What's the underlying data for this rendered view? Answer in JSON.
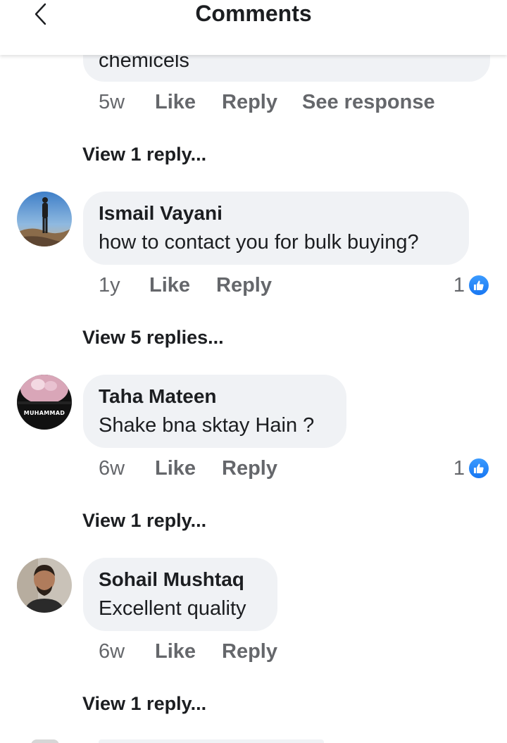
{
  "header": {
    "title": "Comments",
    "back_icon": "chevron-left-icon"
  },
  "partial_comment": {
    "text": "chemicels",
    "time": "5w",
    "like_label": "Like",
    "reply_label": "Reply",
    "see_response_label": "See response",
    "view_replies": "View 1 reply..."
  },
  "comments": [
    {
      "name": "Ismail Vayani",
      "text": "how to contact you for bulk buying?",
      "time": "1y",
      "like_label": "Like",
      "reply_label": "Reply",
      "reaction_count": "1",
      "view_replies": "View 5 replies..."
    },
    {
      "name": "Taha Mateen",
      "text": "Shake bna sktay Hain ?",
      "time": "6w",
      "like_label": "Like",
      "reply_label": "Reply",
      "reaction_count": "1",
      "view_replies": "View 1 reply...",
      "avatar_caption": "MUHAMMAD"
    },
    {
      "name": "Sohail Mushtaq",
      "text": "Excellent quality",
      "time": "6w",
      "like_label": "Like",
      "reply_label": "Reply",
      "view_replies": "View 1 reply..."
    }
  ],
  "colors": {
    "bubble": "#f0f2f5",
    "secondary_text": "#65676b",
    "like_blue": "#1877f2"
  }
}
